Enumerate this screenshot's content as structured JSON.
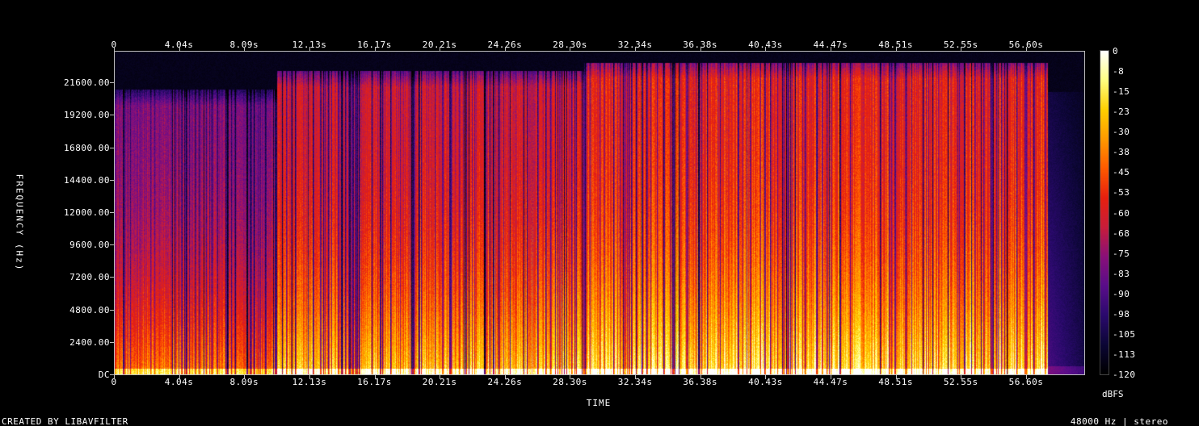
{
  "chart_data": {
    "type": "heatmap",
    "title": "",
    "xlabel": "TIME",
    "ylabel": "FREQUENCY (Hz)",
    "x_ticks": [
      "0",
      "4.04s",
      "8.09s",
      "12.13s",
      "16.17s",
      "20.21s",
      "24.26s",
      "28.30s",
      "32.34s",
      "36.38s",
      "40.43s",
      "44.47s",
      "48.51s",
      "52.55s",
      "56.60s"
    ],
    "x_tick_values": [
      0,
      4.04,
      8.09,
      12.13,
      16.17,
      20.21,
      24.26,
      28.3,
      32.34,
      36.38,
      40.43,
      44.47,
      48.51,
      52.55,
      56.6
    ],
    "xlim": [
      0,
      60.26
    ],
    "y_ticks": [
      "DC",
      "2400.00",
      "4800.00",
      "7200.00",
      "9600.00",
      "12000.00",
      "14400.00",
      "16800.00",
      "19200.00",
      "21600.00"
    ],
    "y_tick_values": [
      0,
      2400,
      4800,
      7200,
      9600,
      12000,
      14400,
      16800,
      19200,
      21600
    ],
    "ylim": [
      0,
      24000
    ],
    "colorbar": {
      "unit": "dBFS",
      "ticks": [
        "0",
        "-8",
        "-15",
        "-23",
        "-30",
        "-38",
        "-45",
        "-53",
        "-60",
        "-68",
        "-75",
        "-83",
        "-90",
        "-98",
        "-105",
        "-113",
        "-120"
      ],
      "range": [
        -120,
        0
      ],
      "colors": [
        "#000000",
        "#0c0636",
        "#2b0a6e",
        "#5a0d8a",
        "#8a1079",
        "#c81d3b",
        "#e8200f",
        "#ff5a00",
        "#ff9a00",
        "#ffd000",
        "#ffff80",
        "#ffffff"
      ]
    },
    "segments": [
      {
        "start": 0,
        "end": 10.1,
        "cutoff_hz": 21200,
        "level": "medium"
      },
      {
        "start": 10.1,
        "end": 29.2,
        "cutoff_hz": 22600,
        "level": "high"
      },
      {
        "start": 29.2,
        "end": 58.0,
        "cutoff_hz": 23200,
        "level": "very-high"
      },
      {
        "start": 58.0,
        "end": 60.26,
        "cutoff_hz": 21000,
        "level": "fade"
      }
    ]
  },
  "footer": {
    "credit": "CREATED BY LIBAVFILTER",
    "format": "48000 Hz | stereo"
  }
}
